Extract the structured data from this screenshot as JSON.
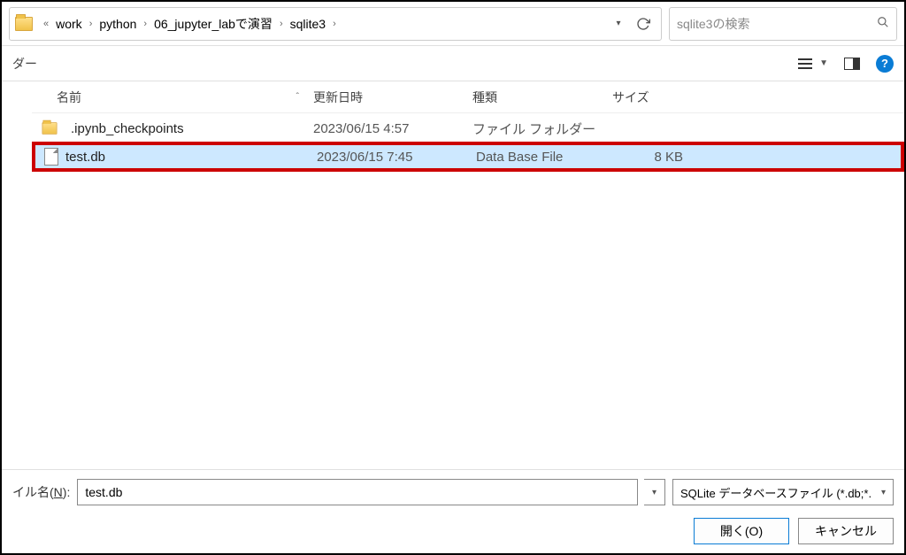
{
  "breadcrumb": {
    "overflow_indicator": "«",
    "items": [
      "work",
      "python",
      "06_jupyter_labで演習",
      "sqlite3"
    ]
  },
  "search": {
    "placeholder": "sqlite3の検索"
  },
  "left_panel_label": "ダー",
  "columns": {
    "name": "名前",
    "date": "更新日時",
    "type": "種類",
    "size": "サイズ"
  },
  "files": [
    {
      "name": ".ipynb_checkpoints",
      "date": "2023/06/15 4:57",
      "type": "ファイル フォルダー",
      "size": "",
      "icon": "folder"
    },
    {
      "name": "test.db",
      "date": "2023/06/15 7:45",
      "type": "Data Base File",
      "size": "8 KB",
      "icon": "file",
      "highlighted": true
    }
  ],
  "filename": {
    "label_prefix": "イル名(",
    "label_accel": "N",
    "label_suffix": "):",
    "value": "test.db"
  },
  "filetype": {
    "selected": "SQLite データベースファイル (*.db;*."
  },
  "buttons": {
    "open": "開く(O)",
    "cancel": "キャンセル"
  }
}
